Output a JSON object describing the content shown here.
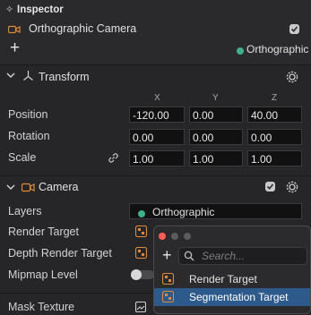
{
  "inspector": {
    "title": "Inspector",
    "object_name": "Orthographic Camera",
    "layer_name": "Orthographic"
  },
  "transform": {
    "title": "Transform",
    "axes": [
      "X",
      "Y",
      "Z"
    ],
    "rows": [
      {
        "label": "Position",
        "values": [
          "-120.00",
          "0.00",
          "40.00"
        ]
      },
      {
        "label": "Rotation",
        "values": [
          "0.00",
          "0.00",
          "0.00"
        ]
      },
      {
        "label": "Scale",
        "values": [
          "1.00",
          "1.00",
          "1.00"
        ]
      }
    ]
  },
  "camera": {
    "title": "Camera",
    "layers_label": "Layers",
    "layers_value": "Orthographic",
    "render_target_label": "Render Target",
    "depth_render_target_label": "Depth Render Target",
    "mipmap_label": "Mipmap Level",
    "mask_texture_label": "Mask Texture"
  },
  "popup": {
    "search_placeholder": "Search...",
    "items": [
      {
        "label": "Render Target",
        "selected": false
      },
      {
        "label": "Segmentation Target",
        "selected": true
      }
    ]
  },
  "colors": {
    "layer_dot": "#3fb08a",
    "camera_icon": "#e08a3a",
    "selection": "#2d5a8a"
  }
}
